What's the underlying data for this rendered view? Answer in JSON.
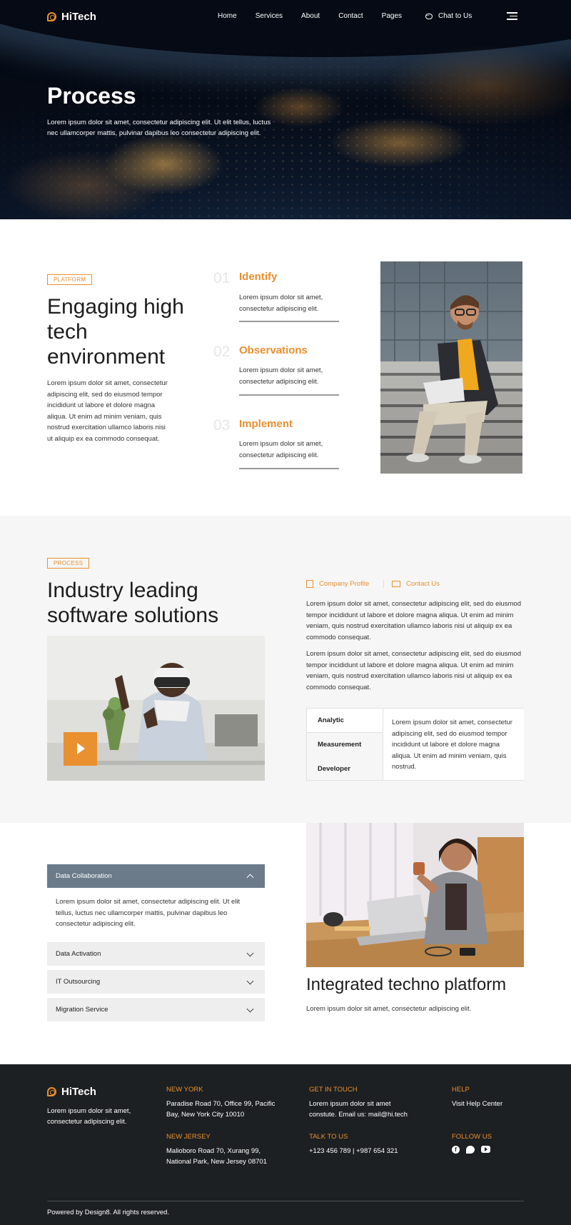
{
  "header": {
    "brand": "HiTech",
    "nav": [
      "Home",
      "Services",
      "About",
      "Contact",
      "Pages"
    ],
    "chat_label": "Chat to Us"
  },
  "hero": {
    "title": "Process",
    "text": "Lorem ipsum dolor sit amet, consectetur adipiscing elit. Ut elit tellus, luctus nec ullamcorper mattis, pulvinar dapibus leo consectetur adipiscing elit."
  },
  "platform": {
    "tag": "PLATFORM",
    "title": "Engaging high tech environment",
    "text": "Lorem ipsum dolor sit amet, consectetur adipiscing elit, sed do eiusmod tempor incididunt ut labore et dolore magna aliqua. Ut enim ad minim veniam, quis nostrud exercitation ullamco laboris nisi ut aliquip ex ea commodo consequat.",
    "steps": [
      {
        "num": "01",
        "title": "Identify",
        "text": "Lorem ipsum dolor sit amet, consectetur adipiscing elit."
      },
      {
        "num": "02",
        "title": "Observations",
        "text": "Lorem ipsum dolor sit amet, consectetur adipiscing elit."
      },
      {
        "num": "03",
        "title": "Implement",
        "text": "Lorem ipsum dolor sit amet, consectetur adipiscing elit."
      }
    ]
  },
  "process": {
    "tag": "PROCESS",
    "title": "Industry leading software solutions",
    "links": [
      "Company Profile",
      "Contact Us"
    ],
    "para1": "Lorem ipsum dolor sit amet, consectetur adipiscing elit, sed do eiusmod tempor incididunt ut labore et dolore magna aliqua. Ut enim ad minim veniam, quis nostrud exercitation ullamco laboris nisi ut aliquip ex ea commodo consequat.",
    "para2": "Lorem ipsum dolor sit amet, consectetur adipiscing elit, sed do eiusmod tempor incididunt ut labore et dolore magna aliqua. Ut enim ad minim veniam, quis nostrud exercitation ullamco laboris nisi ut aliquip ex ea commodo consequat.",
    "tabs": [
      "Analytic",
      "Measurement",
      "Developer"
    ],
    "tab_text": "Lorem ipsum dolor sit amet, consectetur adipiscing elit, sed do eiusmod tempor incididunt ut labore et dolore magna aliqua. Ut enim ad minim veniam, quis nostrud."
  },
  "accordion": {
    "items": [
      "Data Collaboration",
      "Data Activation",
      "IT Outsourcing",
      "Migration Service"
    ],
    "open_text": "Lorem ipsum dolor sit amet, consectetur adipiscing elit. Ut elit tellus, luctus nec ullamcorper mattis, pulvinar dapibus leo consectetur adipiscing elit."
  },
  "integrated": {
    "title": "Integrated techno platform",
    "text": "Lorem ipsum dolor sit amet, consectetur adipiscing elit."
  },
  "footer": {
    "brand": "HiTech",
    "about": "Lorem ipsum dolor sit amet, consectetur adipiscing elit.",
    "ny_heading": "NEW YORK",
    "ny_text": "Paradise Road 70, Office 99, Pacific Bay,  New York City 10010",
    "nj_heading": "NEW JERSEY",
    "nj_text": "Malioboro Road 70, Xurang 99, National Park, New Jersey 08701",
    "touch_heading": "GET IN TOUCH",
    "touch_text": "Lorem ipsum dolor sit amet constute. Email us: mail@hi.tech",
    "talk_heading": "TALK TO US",
    "talk_text": "+123 456 789 | +987 654 321",
    "help_heading": "HELP",
    "help_link": "Visit Help Center",
    "follow_heading": "FOLLOW US",
    "copyright": "Powered by Design8. All rights reserved.",
    "social_icons": [
      "facebook-icon",
      "twitter-icon",
      "youtube-icon"
    ]
  },
  "colors": {
    "accent": "#e9902f",
    "dark": "#1d2022",
    "accordion_open": "#6b7b8a"
  }
}
